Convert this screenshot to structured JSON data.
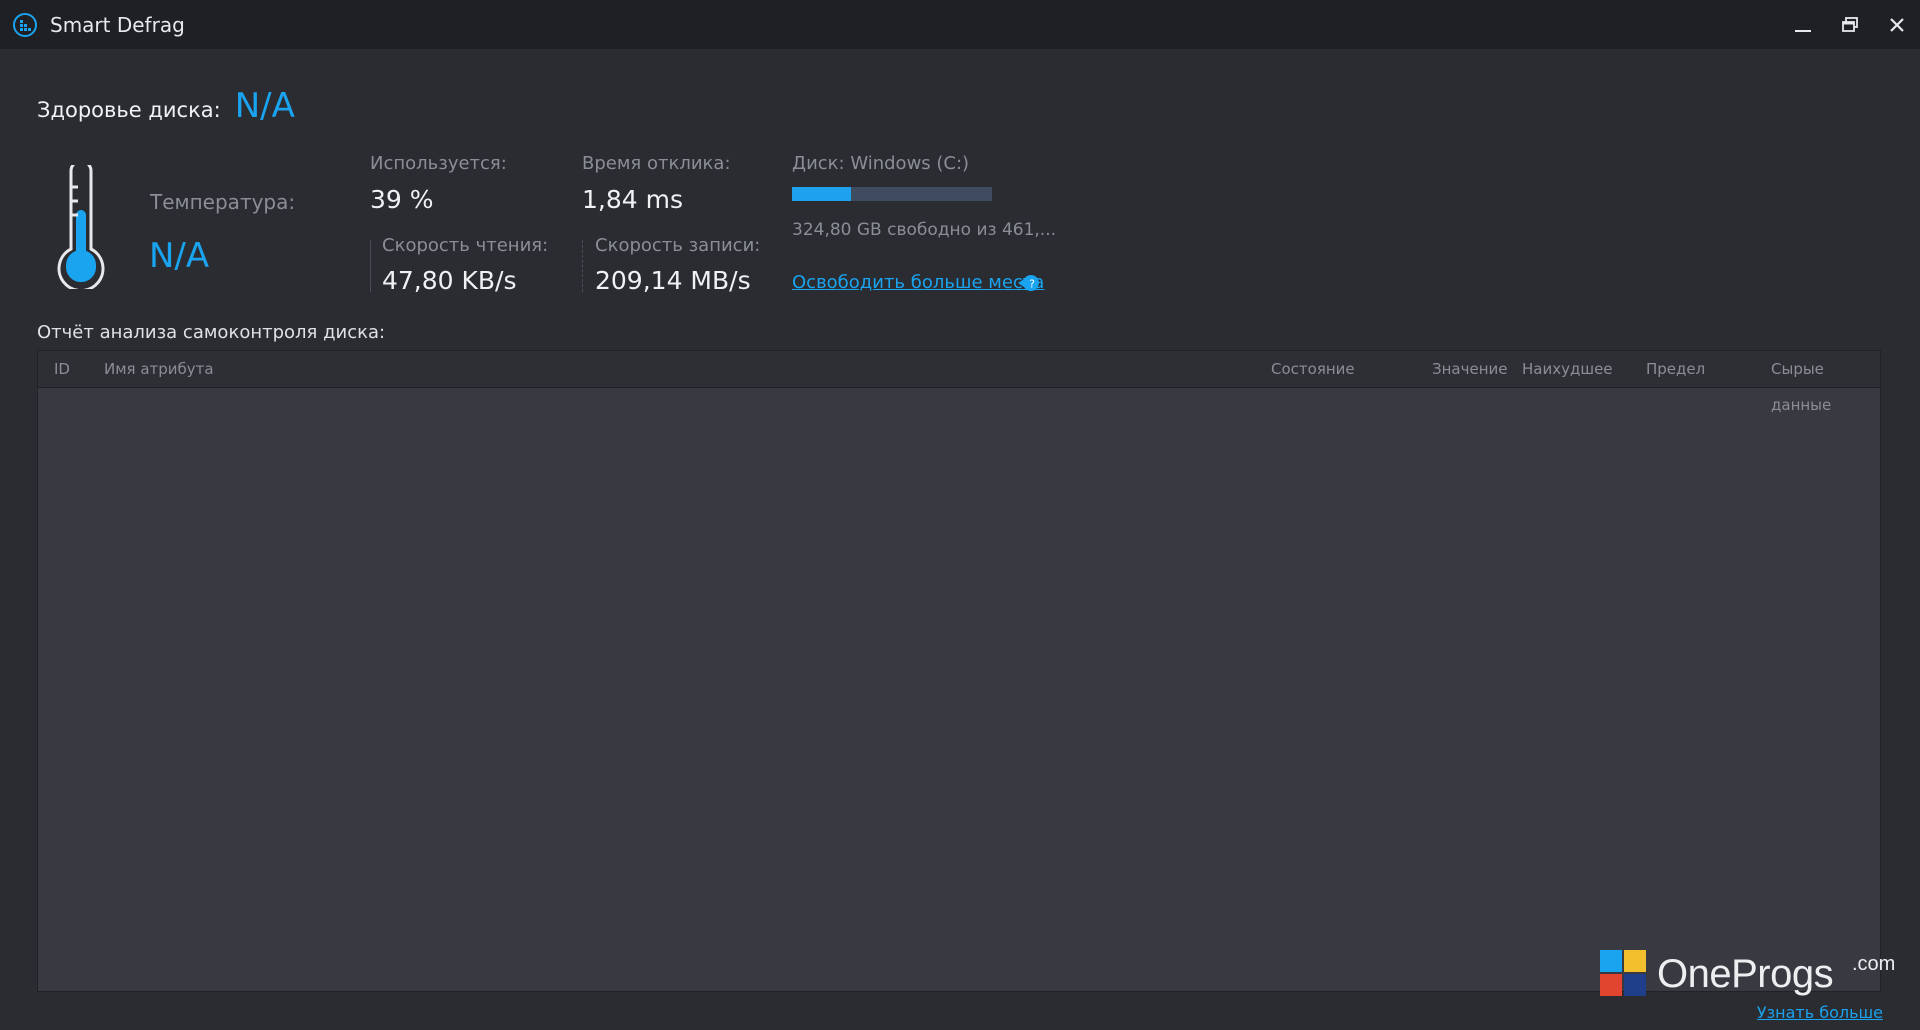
{
  "window": {
    "title": "Smart Defrag",
    "icons": {
      "app": "defrag-app-icon",
      "minimize": "minimize-icon",
      "restore": "restore-icon",
      "close": "close-icon"
    }
  },
  "health": {
    "label": "Здоровье диска:",
    "value": "N/A"
  },
  "temperature": {
    "label": "Температура:",
    "value": "N/A",
    "icon": "thermometer-icon"
  },
  "stats": {
    "usage": {
      "label": "Используется:",
      "value": "39 %"
    },
    "response": {
      "label": "Время отклика:",
      "value": "1,84 ms"
    },
    "read": {
      "label": "Скорость чтения:",
      "value": "47,80 KB/s"
    },
    "write": {
      "label": "Скорость записи:",
      "value": "209,14 MB/s"
    }
  },
  "disk": {
    "label": "Диск: Windows (C:)",
    "used_fraction": 0.296,
    "free_text": "324,80 GB свободно из 461,...",
    "free_link": "Освободить больше места",
    "help_icon": "help-bubble-icon"
  },
  "report": {
    "label": "Отчёт анализа самоконтроля диска:",
    "columns": [
      "ID",
      "Имя атрибута",
      "Состояние",
      "Значение",
      "Наихудшее",
      "Предел",
      "Сырые данные"
    ]
  },
  "watermark": {
    "brand": "OneProgs",
    "suffix": ".com",
    "logo_icon": "windows-logo-icon"
  },
  "footer": {
    "learn_more": "Узнать больше"
  },
  "colors": {
    "accent": "#1aa3ef",
    "background": "#2a2c31",
    "titlebar": "#1f2024"
  }
}
